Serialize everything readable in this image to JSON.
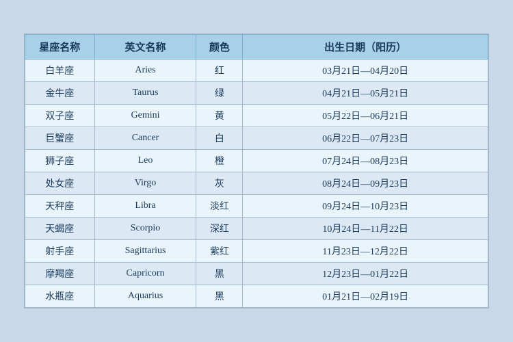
{
  "table": {
    "headers": [
      "星座名称",
      "英文名称",
      "颜色",
      "出生日期（阳历）"
    ],
    "rows": [
      {
        "zh": "白羊座",
        "en": "Aries",
        "color": "红",
        "date": "03月21日—04月20日"
      },
      {
        "zh": "金牛座",
        "en": "Taurus",
        "color": "绿",
        "date": "04月21日—05月21日"
      },
      {
        "zh": "双子座",
        "en": "Gemini",
        "color": "黄",
        "date": "05月22日—06月21日"
      },
      {
        "zh": "巨蟹座",
        "en": "Cancer",
        "color": "白",
        "date": "06月22日—07月23日"
      },
      {
        "zh": "狮子座",
        "en": "Leo",
        "color": "橙",
        "date": "07月24日—08月23日"
      },
      {
        "zh": "处女座",
        "en": "Virgo",
        "color": "灰",
        "date": "08月24日—09月23日"
      },
      {
        "zh": "天秤座",
        "en": "Libra",
        "color": "淡红",
        "date": "09月24日—10月23日"
      },
      {
        "zh": "天蝎座",
        "en": "Scorpio",
        "color": "深红",
        "date": "10月24日—11月22日"
      },
      {
        "zh": "射手座",
        "en": "Sagittarius",
        "color": "紫红",
        "date": "11月23日—12月22日"
      },
      {
        "zh": "摩羯座",
        "en": "Capricorn",
        "color": "黑",
        "date": "12月23日—01月22日"
      },
      {
        "zh": "水瓶座",
        "en": "Aquarius",
        "color": "黑",
        "date": "01月21日—02月19日"
      }
    ]
  }
}
